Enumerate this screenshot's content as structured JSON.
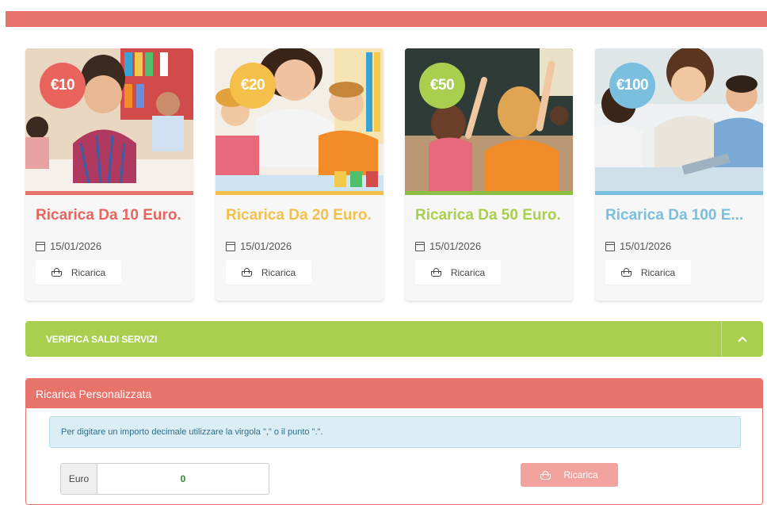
{
  "cards": [
    {
      "price": "€10",
      "title": "Ricarica Da 10 Euro.",
      "date": "15/01/2026",
      "button": "Ricarica",
      "color": "#e8645d",
      "underline": "#e8736a"
    },
    {
      "price": "€20",
      "title": "Ricarica Da 20 Euro.",
      "date": "15/01/2026",
      "button": "Ricarica",
      "color": "#f5c04a",
      "underline": "#f5c04a"
    },
    {
      "price": "€50",
      "title": "Ricarica Da 50 Euro.",
      "date": "15/01/2026",
      "button": "Ricarica",
      "color": "#a8cf4e",
      "underline": "#8fbf45"
    },
    {
      "price": "€100",
      "title": "Ricarica Da 100 E...",
      "date": "15/01/2026",
      "button": "Ricarica",
      "color": "#7bbfde",
      "underline": "#7bbfde"
    }
  ],
  "verify": {
    "label": "VERIFICA SALDI SERVIZI"
  },
  "custom": {
    "title": "Ricarica Personalizzata",
    "info": "Per digitare un importo decimale utilizzare la virgola \",\" o il punto \".\".",
    "currency_label": "Euro",
    "amount_value": "0",
    "button": "Ricarica"
  },
  "colors": {
    "brand_red": "#e8736a",
    "green": "#a8cf4e",
    "info_bg": "#dbeef5"
  }
}
